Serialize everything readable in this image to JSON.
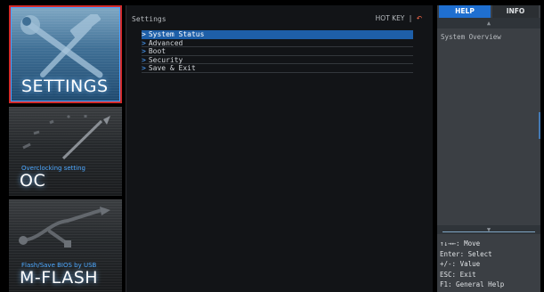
{
  "sidebar": {
    "tiles": [
      {
        "id": "settings",
        "title": "SETTINGS",
        "subtitle": "",
        "icon": "tools-icon",
        "active": true
      },
      {
        "id": "oc",
        "title": "OC",
        "subtitle": "Overclocking setting",
        "icon": "speedometer-icon",
        "active": false
      },
      {
        "id": "mflash",
        "title": "M-FLASH",
        "subtitle": "Flash/Save BIOS by USB",
        "icon": "usb-icon",
        "active": false
      }
    ]
  },
  "main": {
    "title": "Settings",
    "hotkey_label": "HOT KEY",
    "hotkey_separator": "|",
    "undo_icon": "undo-icon",
    "menu": [
      {
        "label": "System Status",
        "selected": true
      },
      {
        "label": "Advanced",
        "selected": false
      },
      {
        "label": "Boot",
        "selected": false
      },
      {
        "label": "Security",
        "selected": false
      },
      {
        "label": "Save & Exit",
        "selected": false
      }
    ]
  },
  "help_panel": {
    "tabs": [
      {
        "label": "HELP",
        "active": true
      },
      {
        "label": "INFO",
        "active": false
      }
    ],
    "text": "System Overview",
    "key_hints": [
      "↑↓→←: Move",
      "Enter: Select",
      "+/-: Value",
      "ESC: Exit",
      "F1: General Help"
    ]
  },
  "colors": {
    "accent": "#1f6fd0",
    "selection": "#1e5fa8",
    "highlight_box": "#d32b2b"
  }
}
